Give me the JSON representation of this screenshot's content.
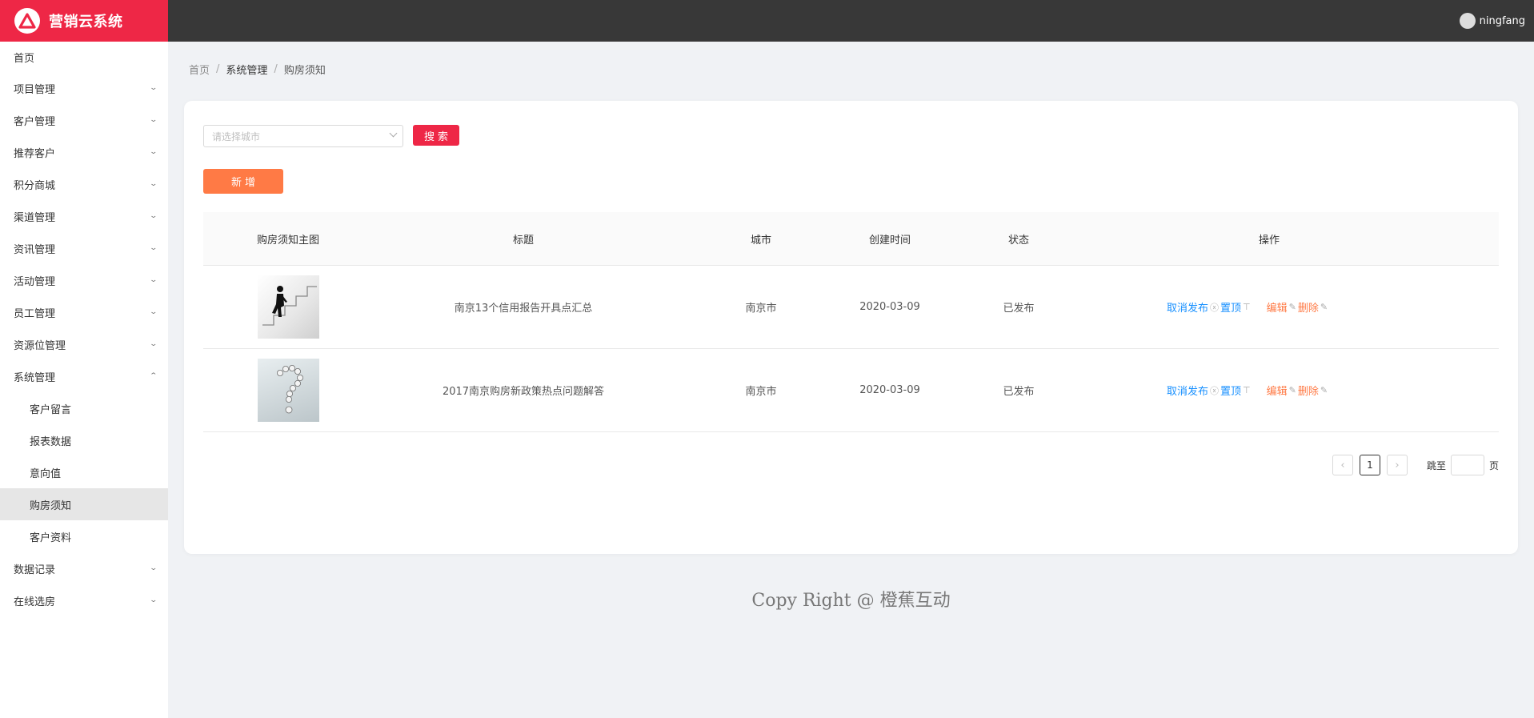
{
  "app": {
    "title": "营销云系统"
  },
  "header": {
    "username": "ningfang"
  },
  "sidebar": {
    "home": "首页",
    "groups": [
      {
        "label": "项目管理"
      },
      {
        "label": "客户管理"
      },
      {
        "label": "推荐客户"
      },
      {
        "label": "积分商城"
      },
      {
        "label": "渠道管理"
      },
      {
        "label": "资讯管理"
      },
      {
        "label": "活动管理"
      },
      {
        "label": "员工管理"
      },
      {
        "label": "资源位管理"
      }
    ],
    "system": {
      "label": "系统管理",
      "items": [
        "客户留言",
        "报表数据",
        "意向值",
        "购房须知",
        "客户资料"
      ],
      "active": "购房须知"
    },
    "after": [
      {
        "label": "数据记录"
      },
      {
        "label": "在线选房"
      }
    ]
  },
  "breadcrumb": [
    "首页",
    "系统管理",
    "购房须知"
  ],
  "filters": {
    "city_placeholder": "请选择城市",
    "search_label": "搜索",
    "add_label": "新增"
  },
  "table": {
    "headers": [
      "购房须知主图",
      "标题",
      "城市",
      "创建时间",
      "状态",
      "操作"
    ],
    "rows": [
      {
        "title": "南京13个信用报告开具点汇总",
        "city": "南京市",
        "created": "2020-03-09",
        "status": "已发布",
        "image": "staircase-walker"
      },
      {
        "title": "2017南京购房新政策热点问题解答",
        "city": "南京市",
        "created": "2020-03-09",
        "status": "已发布",
        "image": "question-mark"
      }
    ],
    "actions": {
      "unpublish": "取消发布",
      "pin": "置顶",
      "edit": "编辑",
      "delete": "删除"
    }
  },
  "pagination": {
    "current": "1",
    "jump_label": "跳至",
    "page_suffix": "页"
  },
  "footer": {
    "text": "Copy Right @ 橙蕉互动"
  },
  "colors": {
    "brand": "#ee2746",
    "header": "#383838",
    "add_button": "#ff7a45",
    "link_blue": "#1890ff",
    "link_orange": "#ff7a45"
  }
}
